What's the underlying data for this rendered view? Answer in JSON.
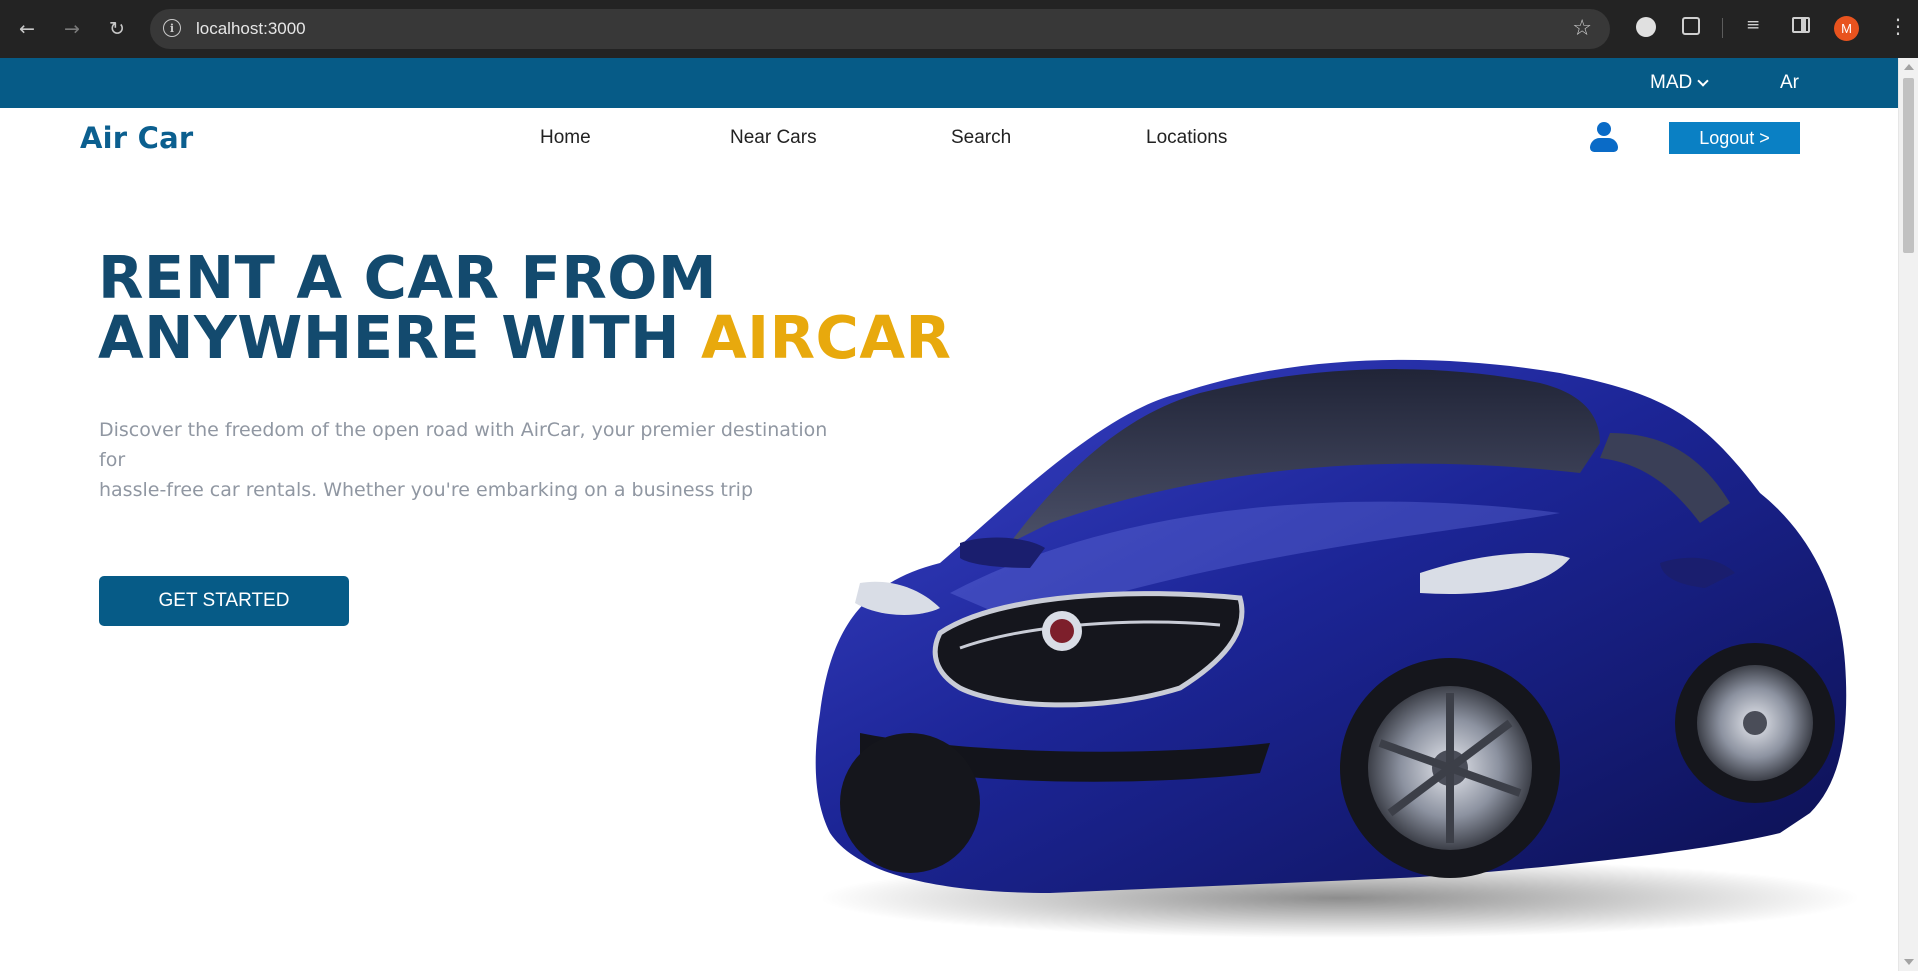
{
  "browser": {
    "url": "localhost:3000",
    "profile_initial": "M"
  },
  "topbar": {
    "currency": "MAD",
    "language": "Ar"
  },
  "navbar": {
    "brand": "Air Car",
    "links": [
      "Home",
      "Near Cars",
      "Search",
      "Locations"
    ],
    "logout_label": "Logout >"
  },
  "hero": {
    "title_line1": "RENT A CAR FROM",
    "title_line2": "ANYWHERE WITH ",
    "title_accent": "AIRCAR",
    "description_line1": "Discover the freedom of the open road with AirCar, your premier destination for",
    "description_line2": "hassle-free car rentals. Whether you're embarking on a business trip",
    "cta_label": "GET STARTED"
  },
  "colors": {
    "brand_blue": "#065b87",
    "accent_yellow": "#e8a90d",
    "title_blue": "#134a6e",
    "logout_blue": "#0a80c4",
    "car_body": "#1c2596"
  },
  "icons": {
    "back": "arrow-left-icon",
    "forward": "arrow-right-icon",
    "reload": "reload-icon",
    "site_info": "info-icon",
    "bookmark": "star-icon",
    "extension": "puzzle-icon",
    "user": "user-icon",
    "dropdown": "chevron-down-icon"
  }
}
